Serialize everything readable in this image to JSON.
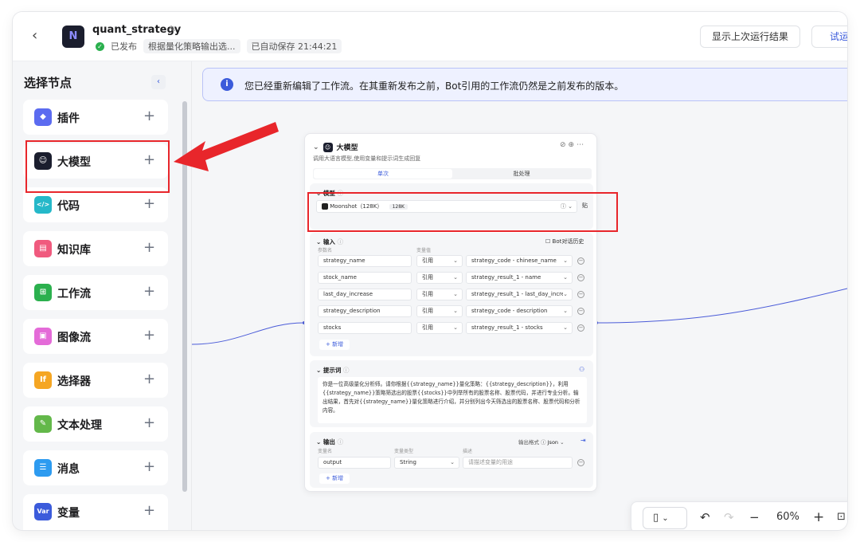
{
  "header": {
    "app_name": "quant_strategy",
    "status": "已发布",
    "description": "根据量化策略输出选...",
    "autosave": "已自动保存 21:44:21",
    "show_last_run": "显示上次运行结果",
    "test_run": "试运",
    "logo_letter": "N"
  },
  "sidebar": {
    "title": "选择节点",
    "items": [
      {
        "label": "插件",
        "icon": "cube-icon",
        "color": "#5b6bf0"
      },
      {
        "label": "大模型",
        "icon": "llm-face-icon",
        "color": "#1b1e2e"
      },
      {
        "label": "代码",
        "icon": "code-icon",
        "color": "#25b8c9"
      },
      {
        "label": "知识库",
        "icon": "knowledge-icon",
        "color": "#f05a7e"
      },
      {
        "label": "工作流",
        "icon": "workflow-icon",
        "color": "#2bb04e"
      },
      {
        "label": "图像流",
        "icon": "imageflow-icon",
        "color": "#e46bd8"
      },
      {
        "label": "选择器",
        "icon": "if-icon",
        "color": "#f5a623"
      },
      {
        "label": "文本处理",
        "icon": "text-icon",
        "color": "#63b84a"
      },
      {
        "label": "消息",
        "icon": "message-icon",
        "color": "#2d9bf0"
      },
      {
        "label": "变量",
        "icon": "var-icon",
        "color": "#3b5bdb"
      }
    ],
    "icon_glyphs": [
      "◆",
      "☺",
      "</>",
      "▤",
      "⊞",
      "▣",
      "If",
      "✎",
      "☰",
      "Var"
    ]
  },
  "notice": {
    "text": "您已经重新编辑了工作流。在其重新发布之前，Bot引用的工作流仍然是之前发布的版本。"
  },
  "llm_node": {
    "title": "大模型",
    "description": "调用大语言模型,使用变量和提示词生成回复",
    "tabs": [
      "单次",
      "批处理"
    ],
    "model": {
      "section_title": "模型",
      "name": "Moonshot（128K）",
      "badge": "128K",
      "extra": "贴"
    },
    "input": {
      "section_title": "输入",
      "bot_history": "Bot对话历史",
      "col_param": "参数名",
      "col_value": "变量值",
      "rows": [
        {
          "name": "strategy_name",
          "type": "引用",
          "ref": "strategy_code - chinese_name"
        },
        {
          "name": "stock_name",
          "type": "引用",
          "ref": "strategy_result_1 - name"
        },
        {
          "name": "last_day_increase",
          "type": "引用",
          "ref": "strategy_result_1 - last_day_incre"
        },
        {
          "name": "strategy_description",
          "type": "引用",
          "ref": "strategy_code - description"
        },
        {
          "name": "stocks",
          "type": "引用",
          "ref": "strategy_result_1 - stocks"
        }
      ],
      "add_label": "+ 新增"
    },
    "prompt": {
      "section_title": "提示词",
      "text": "你是一位高级量化分析师。请你根据{{strategy_name}}量化策略：{{strategy_description}}，利用{{strategy_name}}策略筛选出的股票{{stocks}}中列举所有的股票名称、股票代码，并进行专业分析。输出结果，首先对{{strategy_name}}量化策略进行介绍，并分别列出今天筛选出的股票名称、股票代码和分析内容。"
    },
    "output": {
      "section_title": "输出",
      "format_label": "输出格式",
      "format_value": "Json",
      "col_name": "变量名",
      "col_type": "变量类型",
      "col_desc": "描述",
      "row": {
        "name": "output",
        "type": "String",
        "placeholder": "请描述变量的用途"
      },
      "add_label": "+ 新增"
    }
  },
  "toolbar": {
    "zoom": "60%"
  },
  "colors": {
    "accent": "#3b5bdb",
    "highlight_red": "#e8262b"
  }
}
